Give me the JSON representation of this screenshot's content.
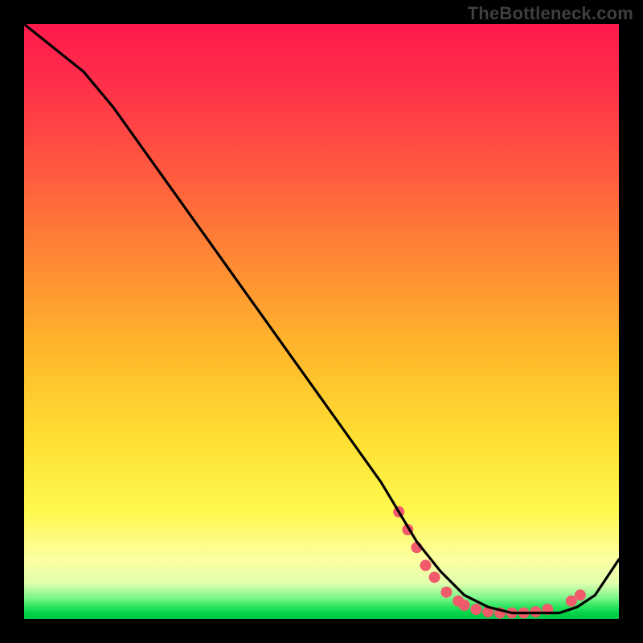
{
  "watermark": "TheBottleneck.com",
  "chart_data": {
    "type": "line",
    "title": "",
    "xlabel": "",
    "ylabel": "",
    "xlim": [
      0,
      100
    ],
    "ylim": [
      0,
      100
    ],
    "series": [
      {
        "name": "curve",
        "color": "#000000",
        "x": [
          0,
          5,
          10,
          15,
          20,
          25,
          30,
          35,
          40,
          45,
          50,
          55,
          60,
          63,
          66,
          70,
          74,
          78,
          82,
          86,
          90,
          93,
          96,
          98,
          100
        ],
        "y": [
          100,
          96,
          92,
          86,
          79,
          72,
          65,
          58,
          51,
          44,
          37,
          30,
          23,
          18,
          13,
          8,
          4,
          2,
          1,
          1,
          1,
          2,
          4,
          7,
          10
        ]
      }
    ],
    "markers": {
      "name": "highlight-dots",
      "color": "#f05a6a",
      "radius": 7,
      "points": [
        {
          "x": 63,
          "y": 18
        },
        {
          "x": 64.5,
          "y": 15
        },
        {
          "x": 66,
          "y": 12
        },
        {
          "x": 67.5,
          "y": 9
        },
        {
          "x": 69,
          "y": 7
        },
        {
          "x": 71,
          "y": 4.5
        },
        {
          "x": 73,
          "y": 3
        },
        {
          "x": 74,
          "y": 2.3
        },
        {
          "x": 76,
          "y": 1.6
        },
        {
          "x": 78,
          "y": 1.2
        },
        {
          "x": 80,
          "y": 1
        },
        {
          "x": 82,
          "y": 1
        },
        {
          "x": 84,
          "y": 1
        },
        {
          "x": 86,
          "y": 1.2
        },
        {
          "x": 88,
          "y": 1.6
        },
        {
          "x": 92,
          "y": 3
        },
        {
          "x": 93.5,
          "y": 4
        }
      ]
    },
    "gradient_bands": [
      {
        "stop": 0,
        "color": "#ff1a4d"
      },
      {
        "stop": 0.55,
        "color": "#ffb82b"
      },
      {
        "stop": 0.82,
        "color": "#fff94f"
      },
      {
        "stop": 0.96,
        "color": "#7bf58a"
      },
      {
        "stop": 1.0,
        "color": "#02c845"
      }
    ]
  }
}
